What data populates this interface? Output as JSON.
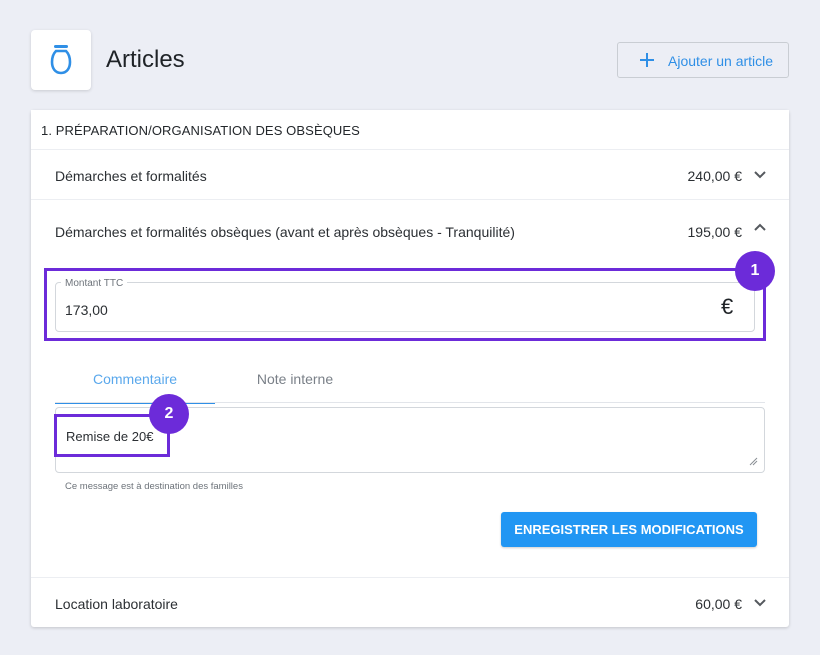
{
  "header": {
    "title": "Articles",
    "add_button_label": "Ajouter un article",
    "logo_icon": "urn-icon"
  },
  "section": {
    "title": "1. PRÉPARATION/ORGANISATION DES OBSÈQUES"
  },
  "articles": [
    {
      "name": "Démarches et formalités",
      "price": "240,00 €",
      "expanded": false
    },
    {
      "name": "Démarches et formalités obsèques (avant et après obsèques - Tranquilité)",
      "price": "195,00 €",
      "expanded": true
    },
    {
      "name": "Location laboratoire",
      "price": "60,00 €",
      "expanded": false
    }
  ],
  "editor": {
    "amount_label": "Montant TTC",
    "amount_value": "173,00",
    "currency_symbol": "€",
    "tabs": [
      "Commentaire",
      "Note interne"
    ],
    "active_tab": "Commentaire",
    "comment_value": "Remise de 20€",
    "helper_text": "Ce message est à destination des familles",
    "save_label": "ENREGISTRER LES MODIFICATIONS"
  },
  "annotations": {
    "badge_1": "1",
    "badge_2": "2"
  },
  "colors": {
    "accent": "#2196f3",
    "highlight": "#6c2bd9",
    "background": "#eceef5"
  }
}
